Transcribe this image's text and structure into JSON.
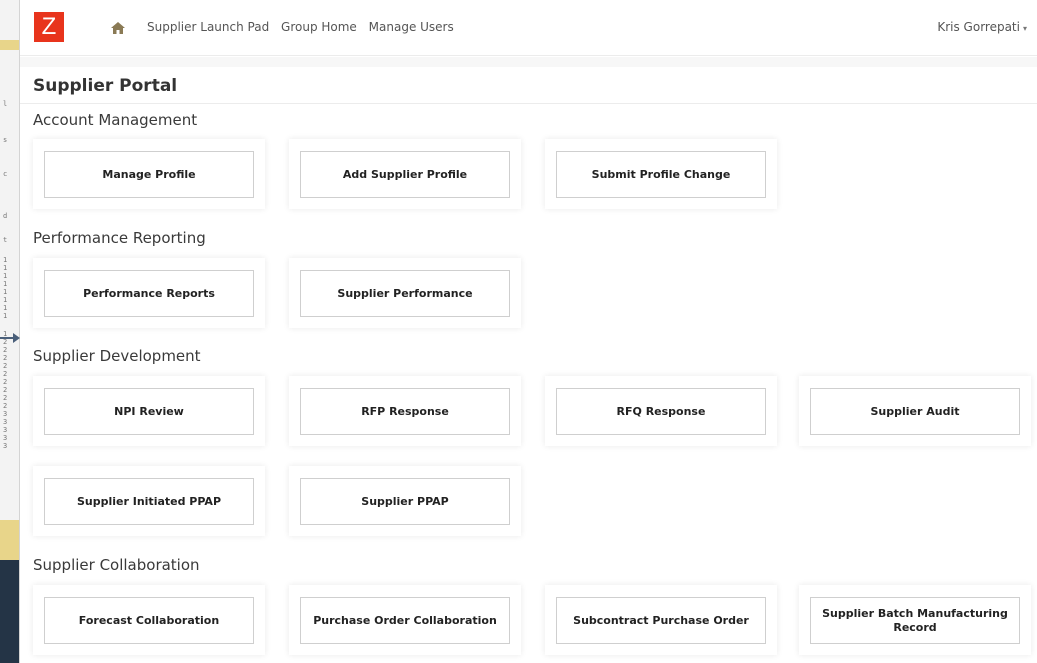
{
  "nav": {
    "logo": "Z",
    "links": [
      "Supplier Launch Pad",
      "Group Home",
      "Manage Users"
    ],
    "user": "Kris Gorrepati",
    "caret": "▾"
  },
  "page": {
    "title": "Supplier Portal"
  },
  "sections": [
    {
      "title": "Account Management",
      "buttons": [
        "Manage Profile",
        "Add Supplier Profile",
        "Submit Profile Change"
      ]
    },
    {
      "title": "Performance Reporting",
      "buttons": [
        "Performance Reports",
        "Supplier Performance"
      ]
    },
    {
      "title": "Supplier Development",
      "buttons": [
        "NPI Review",
        "RFP Response",
        "RFQ Response",
        "Supplier Audit",
        "Supplier Initiated PPAP",
        "Supplier PPAP"
      ]
    },
    {
      "title": "Supplier Collaboration",
      "buttons": [
        "Forecast Collaboration",
        "Purchase Order Collaboration",
        "Subcontract Purchase Order",
        "Supplier Batch Manufacturing Record"
      ]
    }
  ],
  "colors": {
    "logo": "#e8341c",
    "text": "#333333"
  },
  "icons": {
    "home": "home-icon"
  }
}
